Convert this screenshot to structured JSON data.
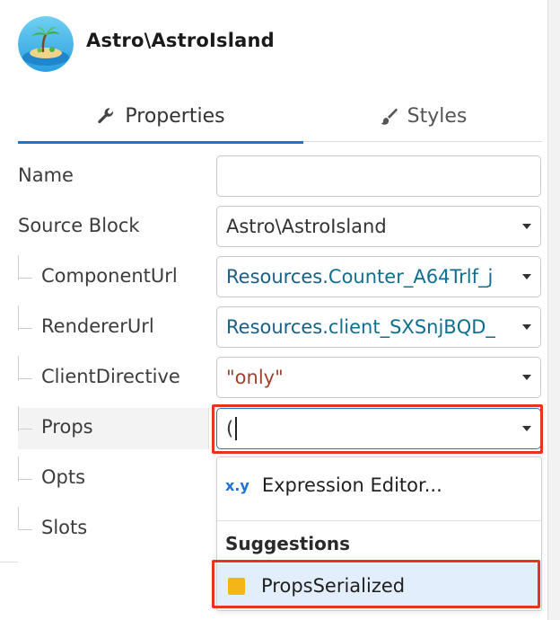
{
  "header": {
    "title": "Astro\\AstroIsland",
    "avatar_icon": "island-avatar-icon"
  },
  "tabs": [
    {
      "label": "Properties",
      "icon": "wrench-icon",
      "active": true
    },
    {
      "label": "Styles",
      "icon": "brush-icon",
      "active": false
    }
  ],
  "fields": {
    "name": {
      "label": "Name",
      "value": ""
    },
    "source_block": {
      "label": "Source Block",
      "value": "Astro\\AstroIsland"
    },
    "component_url": {
      "label": "ComponentUrl",
      "ns": "Resources.",
      "value": "Counter_A64Trlf_j"
    },
    "renderer_url": {
      "label": "RendererUrl",
      "ns": "Resources.",
      "value": "client_SXSnjBQD_"
    },
    "client_directive": {
      "label": "ClientDirective",
      "value": "\"only\""
    },
    "props": {
      "label": "Props",
      "value": "("
    },
    "opts": {
      "label": "Opts"
    },
    "slots": {
      "label": "Slots"
    }
  },
  "popup": {
    "expression_icon": "x.y",
    "expression_label": "Expression Editor...",
    "suggestions_header": "Suggestions",
    "suggestion_item": "PropsSerialized"
  },
  "colors": {
    "accent": "#1a73d9",
    "highlight": "#e8341c",
    "suggestion_bg": "#e2eefc",
    "suggestion_icon": "#f5b518"
  }
}
